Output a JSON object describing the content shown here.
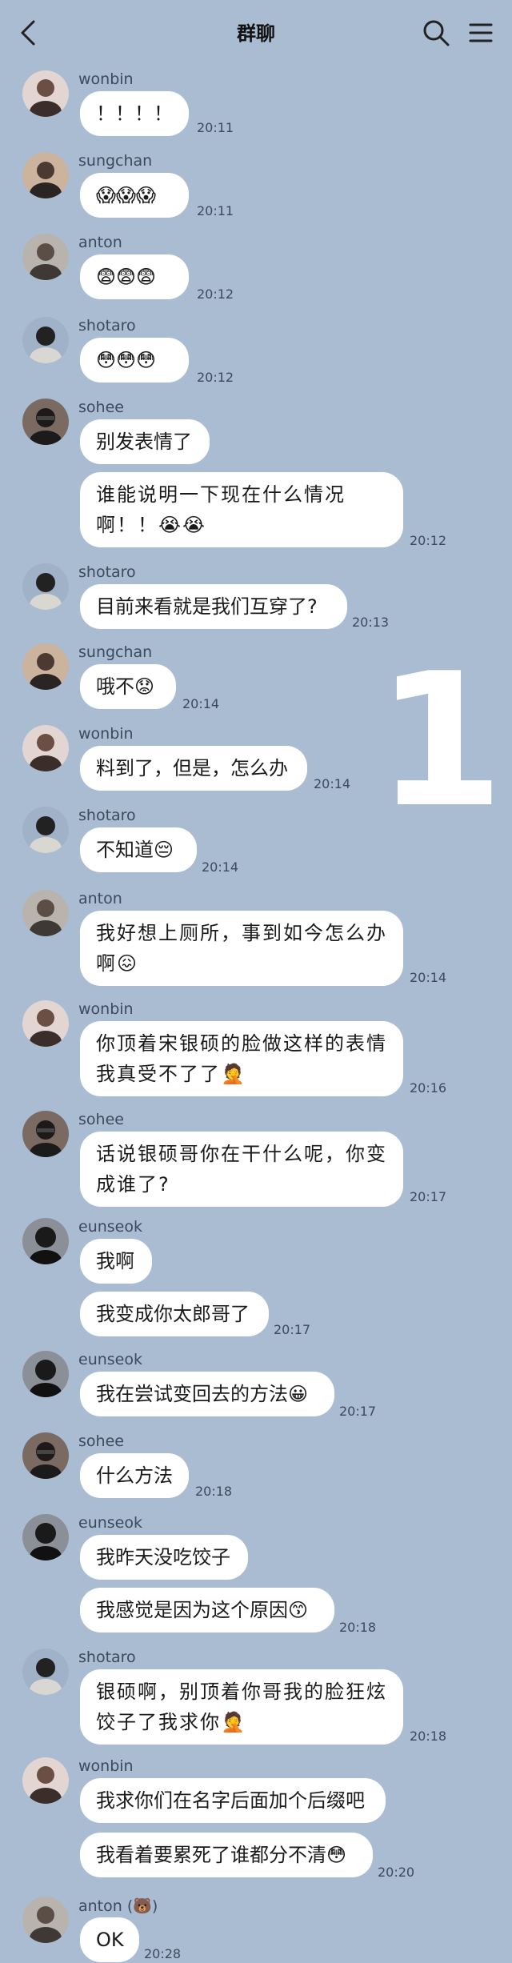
{
  "header": {
    "title": "群聊"
  },
  "overlay_number": "1",
  "messages": [
    {
      "sender": "wonbin",
      "lines": [
        "！！！！"
      ],
      "time": "20:11"
    },
    {
      "sender": "sungchan",
      "lines": [
        "😱😱😱"
      ],
      "time": "20:11"
    },
    {
      "sender": "anton",
      "lines": [
        "😨😨😨"
      ],
      "time": "20:12"
    },
    {
      "sender": "shotaro",
      "lines": [
        "😳😳😳"
      ],
      "time": "20:12"
    },
    {
      "sender": "sohee",
      "lines": [
        "别发表情了"
      ],
      "time": ""
    },
    {
      "sender": "",
      "lines": [
        "谁能说明一下现在什么情况",
        "啊！！😭😭"
      ],
      "time": "20:12"
    },
    {
      "sender": "shotaro",
      "lines": [
        "目前来看就是我们互穿了?"
      ],
      "time": "20:13"
    },
    {
      "sender": "sungchan",
      "lines": [
        "哦不😟"
      ],
      "time": "20:14"
    },
    {
      "sender": "wonbin",
      "lines": [
        "料到了，但是，怎么办"
      ],
      "time": "20:14"
    },
    {
      "sender": "shotaro",
      "lines": [
        "不知道😔"
      ],
      "time": "20:14"
    },
    {
      "sender": "anton",
      "lines": [
        "我好想上厕所，事到如今怎么办",
        "啊😖"
      ],
      "time": "20:14"
    },
    {
      "sender": "wonbin",
      "lines": [
        "你顶着宋银硕的脸做这样的表情",
        "我真受不了了🤦"
      ],
      "time": "20:16"
    },
    {
      "sender": "sohee",
      "lines": [
        "话说银硕哥你在干什么呢，你变",
        "成谁了?"
      ],
      "time": "20:17"
    },
    {
      "sender": "eunseok",
      "lines": [
        "我啊"
      ],
      "time": ""
    },
    {
      "sender": "",
      "lines": [
        "我变成你太郎哥了"
      ],
      "time": "20:17"
    },
    {
      "sender": "eunseok",
      "lines": [
        "我在尝试变回去的方法😀"
      ],
      "time": "20:17"
    },
    {
      "sender": "sohee",
      "lines": [
        "什么方法"
      ],
      "time": "20:18"
    },
    {
      "sender": "eunseok",
      "lines": [
        "我昨天没吃饺子"
      ],
      "time": ""
    },
    {
      "sender": "",
      "lines": [
        "我感觉是因为这个原因😙"
      ],
      "time": "20:18"
    },
    {
      "sender": "shotaro",
      "lines": [
        "银硕啊，别顶着你哥我的脸狂炫",
        "饺子了我求你🤦"
      ],
      "time": "20:18"
    },
    {
      "sender": "wonbin",
      "lines": [
        "我求你们在名字后面加个后缀吧"
      ],
      "time": ""
    },
    {
      "sender": "",
      "lines": [
        "我看着要累死了谁都分不清😳"
      ],
      "time": "20:20"
    },
    {
      "sender": "anton (🐻)",
      "lines": [
        "OK"
      ],
      "time": "20:28"
    }
  ],
  "colors": {
    "background": "#a9bcd2",
    "bubble": "#ffffff",
    "meta_text": "#3b4a5c",
    "overlay_number": "#ffffff"
  }
}
